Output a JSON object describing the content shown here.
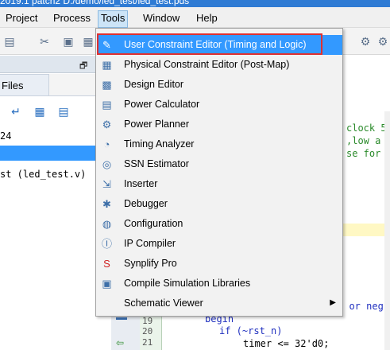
{
  "title_bar": {
    "text": "2019.1 patch2  D:/demo/led_test/led_test.pds"
  },
  "menu": [
    {
      "label": "Project",
      "active": false
    },
    {
      "label": "Process",
      "active": false
    },
    {
      "label": "Tools",
      "active": true
    },
    {
      "label": "Window",
      "active": false
    },
    {
      "label": "Help",
      "active": false
    }
  ],
  "left_panel": {
    "tab": "Files",
    "pin_icon": "pin-icon",
    "tree_number": "24",
    "tree_file": "st (led_test.v)"
  },
  "tools_menu": {
    "items": [
      {
        "label": "User Constraint Editor (Timing and Logic)",
        "icon": "pencil-icon",
        "hover": true
      },
      {
        "label": "Physical Constraint Editor (Post-Map)",
        "icon": "chip-grid-icon"
      },
      {
        "label": "Design Editor",
        "icon": "design-grid-icon"
      },
      {
        "label": "Power Calculator",
        "icon": "calculator-icon"
      },
      {
        "label": "Power Planner",
        "icon": "power-gear-icon"
      },
      {
        "label": "Timing Analyzer",
        "icon": "clock-gear-icon"
      },
      {
        "label": "SSN Estimator",
        "icon": "gauge-icon"
      },
      {
        "label": "Inserter",
        "icon": "inserter-icon"
      },
      {
        "label": "Debugger",
        "icon": "bug-icon"
      },
      {
        "label": "Configuration",
        "icon": "globe-icon"
      },
      {
        "label": "IP Compiler",
        "icon": "ip-icon"
      },
      {
        "label": "Synplify Pro",
        "icon": "synplify-icon"
      },
      {
        "label": "Compile Simulation Libraries",
        "icon": "chart-icon"
      },
      {
        "label": "Schematic Viewer",
        "icon": "",
        "submenu": true
      }
    ]
  },
  "code": {
    "line1": "clock 5",
    "line2": ",low a",
    "line3": "se for",
    "line4": "t or neg",
    "line_begin": "begin",
    "line_if": "if (~rst_n)",
    "line_timer": "timer <= 32'd0;",
    "line_numbers": [
      "19",
      "20",
      "21"
    ]
  },
  "colors": {
    "menu_hover": "#3399ff",
    "highlight_box": "#e03030",
    "comment_green": "#2a8a2a",
    "keyword_blue": "#1f2fbf"
  }
}
